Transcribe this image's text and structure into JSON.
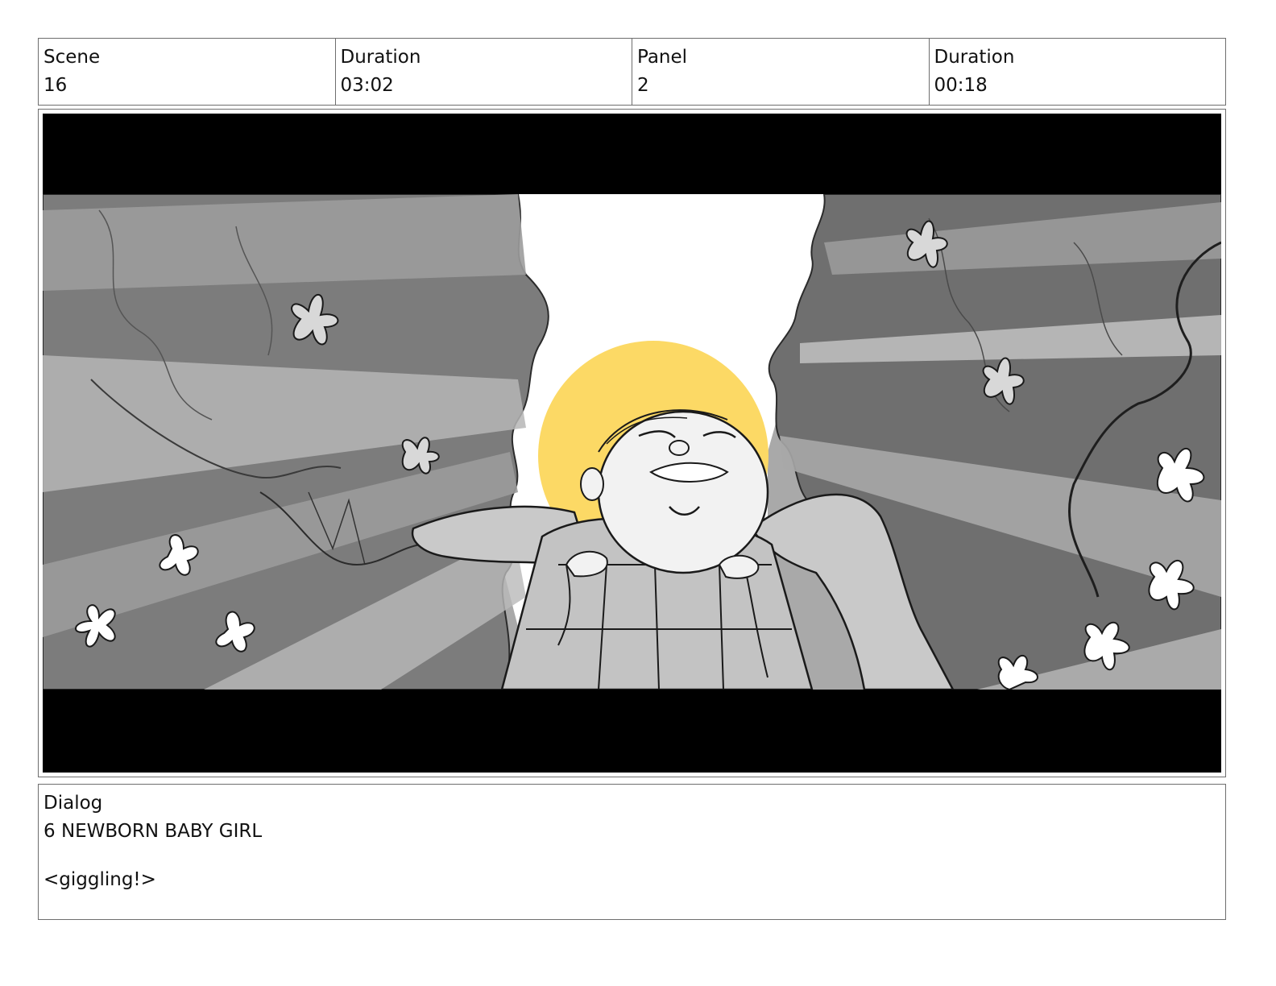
{
  "header": {
    "scene_label": "Scene",
    "scene_value": "16",
    "scene_duration_label": "Duration",
    "scene_duration_value": "03:02",
    "panel_label": "Panel",
    "panel_value": "2",
    "panel_duration_label": "Duration",
    "panel_duration_value": "00:18"
  },
  "dialog": {
    "label": "Dialog",
    "character": "6 NEWBORN BABY GIRL",
    "line": "<giggling!>"
  },
  "colors": {
    "halo": "#fcd965",
    "letterbox": "#000000",
    "border": "#6e6e6e"
  }
}
